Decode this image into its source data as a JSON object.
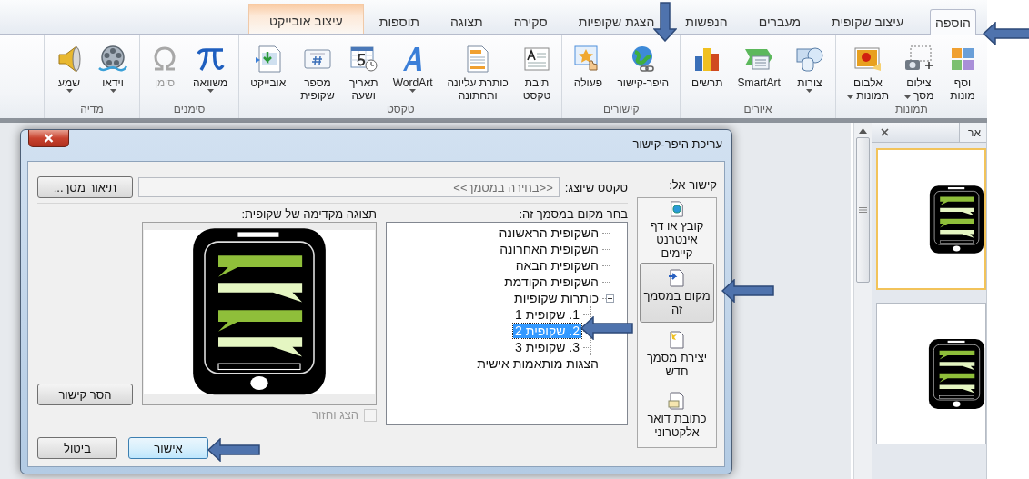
{
  "tabs": [
    {
      "label": "הוספה",
      "selected": true,
      "kind": "standard"
    },
    {
      "label": "עיצוב שקופית",
      "selected": false,
      "kind": "standard"
    },
    {
      "label": "מעברים",
      "selected": false,
      "kind": "standard"
    },
    {
      "label": "הנפשות",
      "selected": false,
      "kind": "standard"
    },
    {
      "label": "הצגת שקופיות",
      "selected": false,
      "kind": "standard"
    },
    {
      "label": "סקירה",
      "selected": false,
      "kind": "standard"
    },
    {
      "label": "תצוגה",
      "selected": false,
      "kind": "standard"
    },
    {
      "label": "תוספות",
      "selected": false,
      "kind": "standard"
    },
    {
      "label": "עיצוב אובייקט",
      "selected": false,
      "kind": "contextual"
    }
  ],
  "ribbon": {
    "groups": [
      {
        "label": "תמונות",
        "buttons": [
          {
            "label": "וסף\nמונות",
            "dropdown": false,
            "disabled": false
          },
          {
            "label": "צילום\nמסך",
            "dropdown": true,
            "disabled": false
          },
          {
            "label": "אלבום\nתמונות",
            "dropdown": true,
            "disabled": false
          }
        ]
      },
      {
        "label": "איורים",
        "buttons": [
          {
            "label": "צורות",
            "dropdown": true,
            "disabled": false
          },
          {
            "label": "SmartArt",
            "dropdown": false,
            "disabled": false
          },
          {
            "label": "תרשים",
            "dropdown": false,
            "disabled": false
          }
        ]
      },
      {
        "label": "קישורים",
        "buttons": [
          {
            "label": "היפר-קישור",
            "dropdown": false,
            "disabled": false
          },
          {
            "label": "פעולה",
            "dropdown": false,
            "disabled": false
          }
        ]
      },
      {
        "label": "טקסט",
        "buttons": [
          {
            "label": "תיבת\nטקסט",
            "dropdown": false,
            "disabled": false
          },
          {
            "label": "כותרת עליונה\nותחתונה",
            "dropdown": false,
            "disabled": false
          },
          {
            "label": "WordArt",
            "dropdown": true,
            "disabled": false
          },
          {
            "label": "תאריך\nושעה",
            "dropdown": false,
            "disabled": false
          },
          {
            "label": "מספר\nשקופית",
            "dropdown": false,
            "disabled": false
          },
          {
            "label": "אובייקט",
            "dropdown": false,
            "disabled": false
          }
        ]
      },
      {
        "label": "סימנים",
        "buttons": [
          {
            "label": "משוואה",
            "dropdown": true,
            "disabled": false
          },
          {
            "label": "סימן",
            "dropdown": false,
            "disabled": true
          }
        ]
      },
      {
        "label": "מדיה",
        "buttons": [
          {
            "label": "וידאו",
            "dropdown": true,
            "disabled": false
          },
          {
            "label": "שמע",
            "dropdown": true,
            "disabled": false
          }
        ]
      }
    ]
  },
  "dialog": {
    "title": "עריכת היפר-קישור",
    "link_to_label": "קישור אל:",
    "link_targets": [
      {
        "label": "קובץ או דף\nאינטרנט\nקיימים",
        "selected": false
      },
      {
        "label": "מקום במסמך\nזה",
        "selected": true
      },
      {
        "label": "יצירת מסמך\nחדש",
        "selected": false
      },
      {
        "label": "כתובת דואר\nאלקטרוני",
        "selected": false
      }
    ],
    "display_text_label": "טקסט שיוצג:",
    "display_text_value": "<<בחירה במסמך>>",
    "screentip_button": "תיאור מסך...",
    "place_label": "בחר מקום במסמך זה:",
    "places": [
      {
        "label": "השקופית הראשונה",
        "selected": false
      },
      {
        "label": "השקופית האחרונה",
        "selected": false
      },
      {
        "label": "השקופית הבאה",
        "selected": false
      },
      {
        "label": "השקופית הקודמת",
        "selected": false
      },
      {
        "label": "כותרות שקופיות",
        "selected": false,
        "expanded": true,
        "children": [
          {
            "label": "1. שקופית 1",
            "selected": false
          },
          {
            "label": "2. שקופית 2",
            "selected": true
          },
          {
            "label": "3. שקופית 3",
            "selected": false
          }
        ]
      },
      {
        "label": "הצגות מותאמות אישית",
        "selected": false
      }
    ],
    "preview_label": "תצוגה מקדימה של שקופית:",
    "show_and_return": {
      "label": "הצג וחזור",
      "checked": false,
      "disabled": true
    },
    "remove_link_button": "הסר קישור",
    "ok_button": "אישור",
    "cancel_button": "ביטול"
  },
  "slides_panel": {
    "tab_label": "אר",
    "slides": [
      {
        "selected": true
      },
      {
        "selected": false
      }
    ]
  }
}
